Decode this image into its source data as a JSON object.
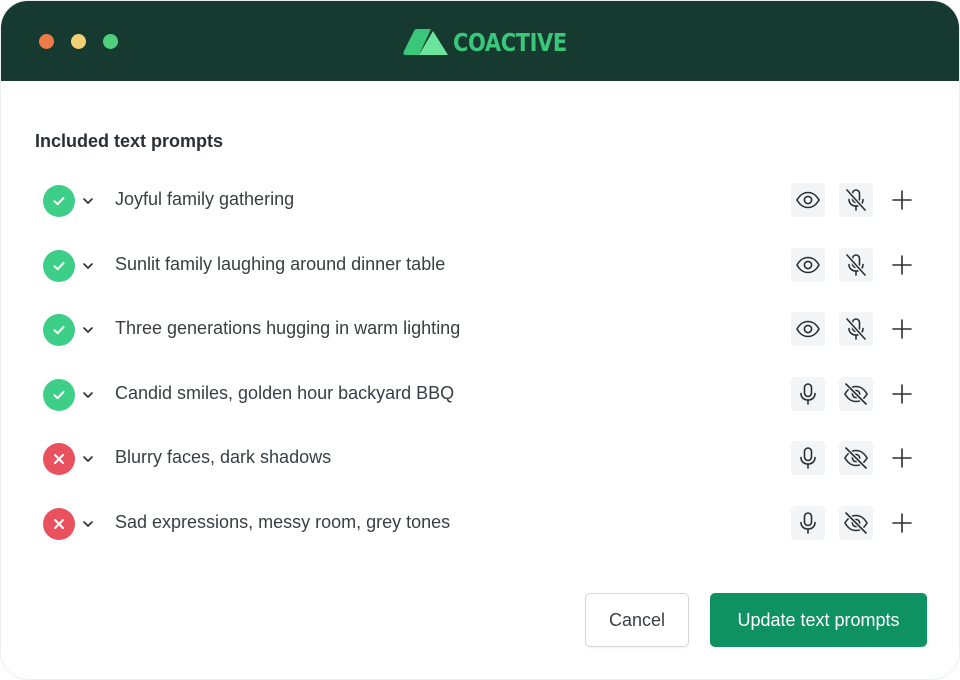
{
  "window": {
    "brand": "COACTIVE",
    "colors": {
      "titlebar": "#163a30",
      "brand": "#39c77a",
      "accent": "#0e9261",
      "ok": "#3dcf88",
      "bad": "#e9515f"
    }
  },
  "section": {
    "title": "Included text prompts"
  },
  "prompts": [
    {
      "label": "Joyful family gathering",
      "status": "included",
      "status_icon": "check-icon",
      "btn1_icon": "eye-icon",
      "btn2_icon": "mic-off-icon"
    },
    {
      "label": "Sunlit family laughing around dinner table",
      "status": "included",
      "status_icon": "check-icon",
      "btn1_icon": "eye-icon",
      "btn2_icon": "mic-off-icon"
    },
    {
      "label": "Three generations hugging in warm lighting",
      "status": "included",
      "status_icon": "check-icon",
      "btn1_icon": "eye-icon",
      "btn2_icon": "mic-off-icon"
    },
    {
      "label": "Candid smiles, golden hour backyard BBQ",
      "status": "included",
      "status_icon": "check-icon",
      "btn1_icon": "mic-icon",
      "btn2_icon": "eye-off-icon"
    },
    {
      "label": "Blurry faces, dark shadows",
      "status": "excluded",
      "status_icon": "x-icon",
      "btn1_icon": "mic-icon",
      "btn2_icon": "eye-off-icon"
    },
    {
      "label": "Sad expressions, messy room, grey tones",
      "status": "excluded",
      "status_icon": "x-icon",
      "btn1_icon": "mic-icon",
      "btn2_icon": "eye-off-icon"
    }
  ],
  "footer": {
    "cancel_label": "Cancel",
    "update_label": "Update text prompts"
  }
}
